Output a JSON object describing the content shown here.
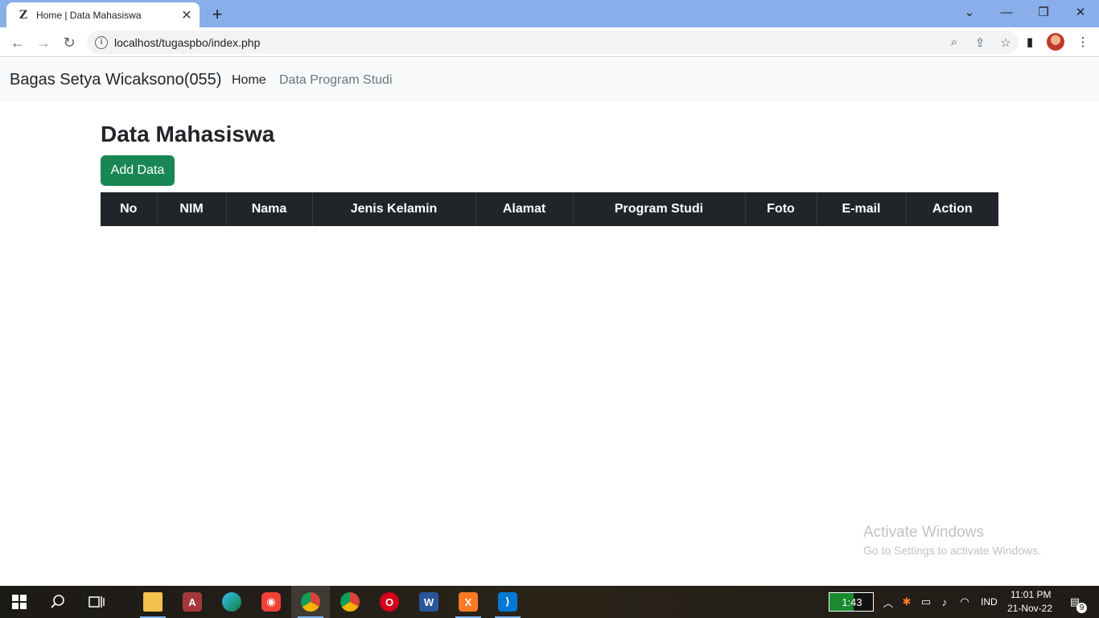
{
  "browser": {
    "tab_title": "Home | Data Mahasiswa",
    "tab_favicon": "Z",
    "new_tab_label": "+",
    "url": "localhost/tugaspbo/index.php"
  },
  "navbar": {
    "brand": "Bagas Setya Wicaksono(055)",
    "links": [
      "Home",
      "Data Program Studi"
    ]
  },
  "main": {
    "title": "Data Mahasiswa",
    "add_button": "Add Data",
    "table": {
      "columns": [
        "No",
        "NIM",
        "Nama",
        "Jenis Kelamin",
        "Alamat",
        "Program Studi",
        "Foto",
        "E-mail",
        "Action"
      ],
      "rows": []
    }
  },
  "watermark": {
    "title": "Activate Windows",
    "subtitle": "Go to Settings to activate Windows."
  },
  "taskbar": {
    "apps": [
      "windows-start-icon",
      "search-icon",
      "task-view-icon",
      "file-explorer-icon",
      "access-icon",
      "edge-icon",
      "camera-app-icon",
      "chrome-profile-icon",
      "chrome-icon",
      "opera-icon",
      "word-icon",
      "xampp-icon",
      "vscode-icon"
    ],
    "battery_widget": "1:43",
    "battery_level": 0.55,
    "language": "IND",
    "time": "11:01 PM",
    "date": "21-Nov-22",
    "notification_count": "9"
  },
  "colors": {
    "tabstrip": "#8aaeea",
    "navbar_bg": "#f8f9fa",
    "button_success": "#198754",
    "table_header": "#212529"
  }
}
